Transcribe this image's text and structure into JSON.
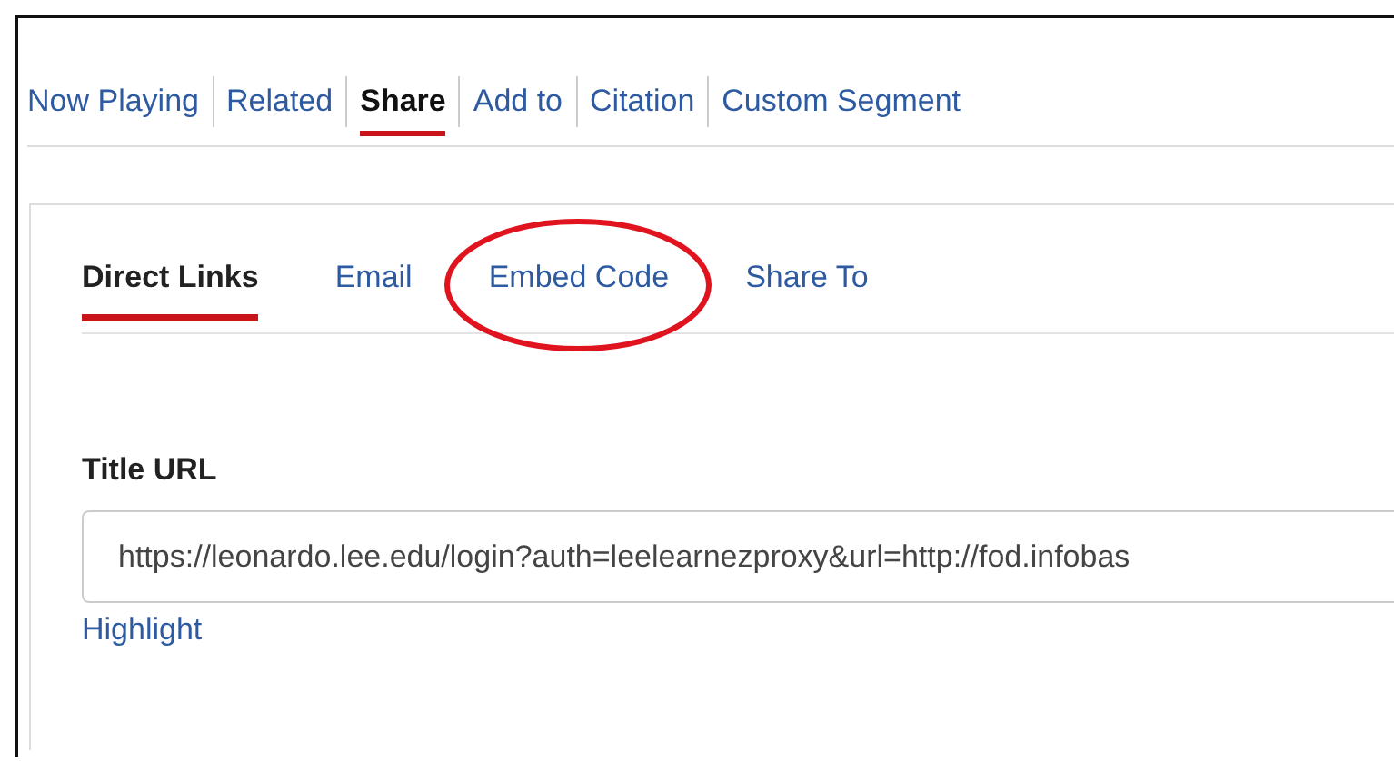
{
  "nav_tabs": [
    {
      "label": "Now Playing",
      "selected": false
    },
    {
      "label": "Related",
      "selected": false
    },
    {
      "label": "Share",
      "selected": true
    },
    {
      "label": "Add to",
      "selected": false
    },
    {
      "label": "Citation",
      "selected": false
    },
    {
      "label": "Custom Segment",
      "selected": false
    }
  ],
  "share_tabs": [
    {
      "label": "Direct Links",
      "selected": true,
      "circled": false
    },
    {
      "label": "Email",
      "selected": false,
      "circled": false
    },
    {
      "label": "Embed Code",
      "selected": false,
      "circled": true
    },
    {
      "label": "Share To",
      "selected": false,
      "circled": false
    }
  ],
  "title_url": {
    "label": "Title URL",
    "value": "https://leonardo.lee.edu/login?auth=leelearnezproxy&url=http://fod.infobas",
    "link": "Highlight"
  }
}
